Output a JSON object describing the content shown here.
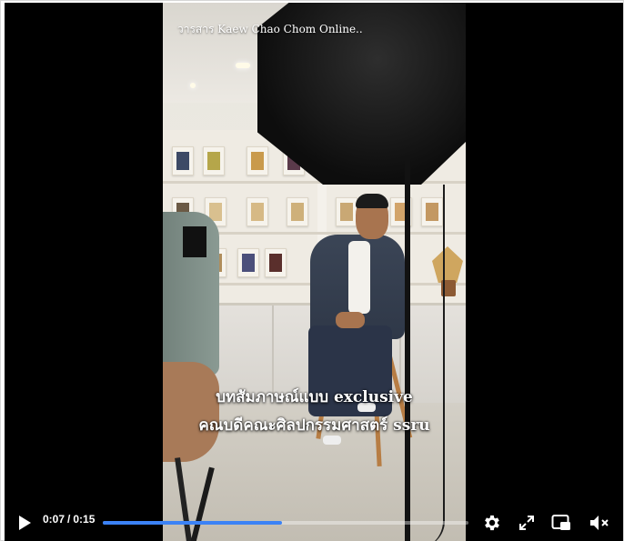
{
  "video": {
    "watermark": "วารสาร Kaew Chao Chom Online..",
    "caption_line1": "บทสัมภาษณ์แบบ exclusive",
    "caption_line2": "คณบดีคณะศิลปกรรมศาสตร์ ssru"
  },
  "controls": {
    "play_icon": "play-icon",
    "current_time": "0:07",
    "separator": "/",
    "duration": "0:15",
    "progress_fraction": 0.49,
    "progress_color": "#3b82f6",
    "settings_icon": "gear-icon",
    "fullscreen_icon": "expand-icon",
    "pip_icon": "picture-in-picture-icon",
    "mute_icon": "speaker-muted-icon"
  }
}
